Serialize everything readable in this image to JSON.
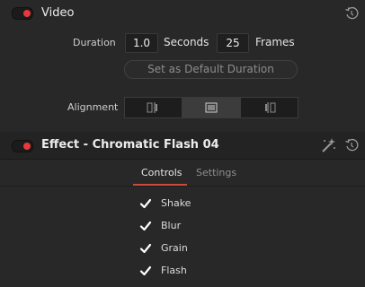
{
  "video": {
    "title": "Video",
    "duration_label": "Duration",
    "duration_value": "1.0",
    "seconds_label": "Seconds",
    "frames_value": "25",
    "frames_label": "Frames",
    "default_button": "Set as Default Duration",
    "alignment_label": "Alignment",
    "alignment_options": [
      "align-left-icon",
      "align-center-icon",
      "align-right-icon"
    ],
    "alignment_selected": 1
  },
  "effect": {
    "title": "Effect - Chromatic Flash 04",
    "tabs": [
      {
        "label": "Controls",
        "active": true
      },
      {
        "label": "Settings",
        "active": false
      }
    ],
    "checks": [
      {
        "label": "Shake",
        "checked": true
      },
      {
        "label": "Blur",
        "checked": true
      },
      {
        "label": "Grain",
        "checked": true
      },
      {
        "label": "Flash",
        "checked": true
      }
    ]
  },
  "colors": {
    "accent_red": "#e8383a",
    "tab_underline": "#c9493a",
    "background": "#282828"
  }
}
